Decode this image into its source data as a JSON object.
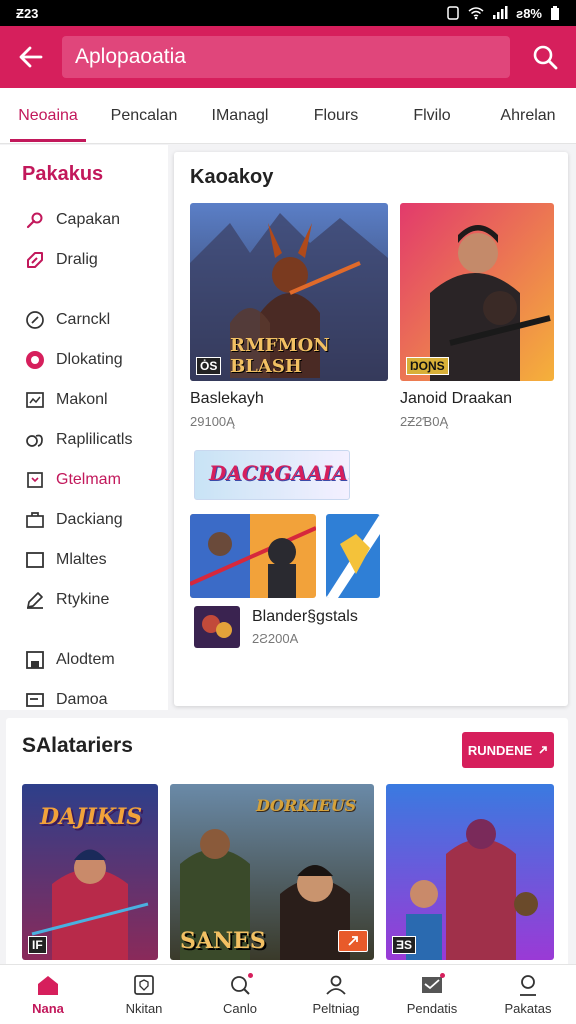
{
  "status": {
    "time": "Ƶ23",
    "battery": "ƨ8%"
  },
  "app_bar": {
    "title": "Aplopaoatia"
  },
  "tabs": [
    "Neoaina",
    "Pencalan",
    "IManagl",
    "Flours",
    "Flvilo",
    "Ahrelan"
  ],
  "sidebar": {
    "heading": "Pakakus",
    "items": [
      {
        "label": "Capakan",
        "icon": "pin-icon"
      },
      {
        "label": "Dralig",
        "icon": "tag-icon"
      },
      {
        "label": "Carnckl",
        "icon": "compass-icon"
      },
      {
        "label": "Dlokating",
        "icon": "record-icon"
      },
      {
        "label": "Makonl",
        "icon": "picture-icon"
      },
      {
        "label": "Raplilicatls",
        "icon": "link-icon"
      },
      {
        "label": "Gtelmam",
        "icon": "calendar-icon"
      },
      {
        "label": "Dackiang",
        "icon": "briefcase-icon"
      },
      {
        "label": "Mlaltes",
        "icon": "square-icon"
      },
      {
        "label": "Rtykine",
        "icon": "edit-icon"
      },
      {
        "label": "Alodtem",
        "icon": "save-icon"
      },
      {
        "label": "Damoa",
        "icon": "card-icon"
      }
    ]
  },
  "card": {
    "title": "Kaoakoy",
    "games": [
      {
        "name": "Baslekayh",
        "count": "29100Ą",
        "art_text": "RMFMON BLASH",
        "badge": "ȮS"
      },
      {
        "name": "Janoid Draakan",
        "count": "2Ƶ2Ɓ0Ą",
        "art_text": "",
        "badge": "ŊOƝS"
      }
    ],
    "banner_text": "DACRGAAIA!",
    "small_item": {
      "name": "Blander§ɡstals",
      "count": "2Ƨ200A"
    }
  },
  "section": {
    "title": "SAlatariers",
    "button_label": "RUNDENE",
    "tiles": [
      {
        "art_text": "DAJIKIS",
        "badge": "IF"
      },
      {
        "art_text": "SANES",
        "logo_text": "DORKIEUS"
      },
      {
        "art_text": "",
        "badge": "ƎS"
      }
    ]
  },
  "bottom_nav": [
    {
      "label": "Nana",
      "icon": "home-icon"
    },
    {
      "label": "Nkitan",
      "icon": "shield-icon"
    },
    {
      "label": "Canlo",
      "icon": "search-icon"
    },
    {
      "label": "Peltniag",
      "icon": "user-icon"
    },
    {
      "label": "Pendatis",
      "icon": "mail-icon"
    },
    {
      "label": "Pakatas",
      "icon": "profile-icon"
    }
  ],
  "colors": {
    "brand": "#d61f5c",
    "accent": "#c2185b"
  }
}
